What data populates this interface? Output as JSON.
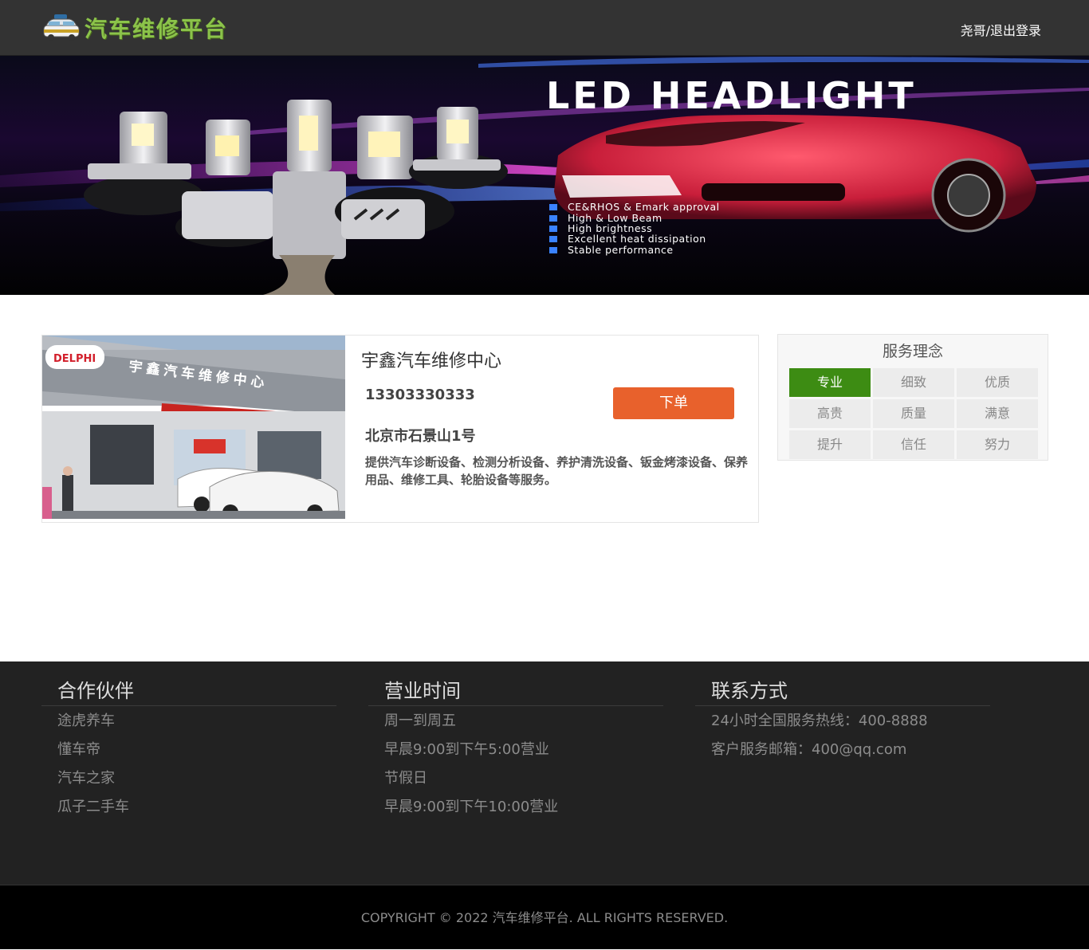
{
  "header": {
    "logo_text": "汽车维修平台",
    "username": "尧哥",
    "separator": "/",
    "logout_label": "退出登录"
  },
  "banner": {
    "headline": "LED HEADLIGHT",
    "features": [
      "CE&RHOS & Emark approval",
      "High & Low Beam",
      "High brightness",
      "Excellent heat dissipation",
      "Stable performance"
    ]
  },
  "shop": {
    "name": "宇鑫汽车维修中心",
    "phone": "13303330333",
    "address": "北京市石景山1号",
    "description": "提供汽车诊断设备、检测分析设备、养护清洗设备、钣金烤漆设备、保养用品、维修工具、轮胎设备等服务。",
    "order_label": "下单",
    "photo": {
      "sign_text": "宇鑫汽车维修中心",
      "brand_text": "DELPHI"
    }
  },
  "service": {
    "title": "服务理念",
    "items": [
      "专业",
      "细致",
      "优质",
      "高贵",
      "质量",
      "满意",
      "提升",
      "信任",
      "努力"
    ],
    "active_index": 0
  },
  "footer": {
    "partners": {
      "title": "合作伙伴",
      "items": [
        "途虎养车",
        "懂车帝",
        "汽车之家",
        "瓜子二手车"
      ]
    },
    "hours": {
      "title": "营业时间",
      "items": [
        "周一到周五",
        "早晨9:00到下午5:00营业",
        "节假日",
        "早晨9:00到下午10:00营业"
      ]
    },
    "contact": {
      "title": "联系方式",
      "items": [
        "24小时全国服务热线：400-8888",
        "客户服务邮箱：400@qq.com"
      ]
    },
    "copyright": "COPYRIGHT © 2022 汽车维修平台. ALL RIGHTS RESERVED."
  },
  "colors": {
    "header_bg": "#333333",
    "logo_green": "#8bc34a",
    "order_orange": "#e8612c",
    "active_green": "#3d8c13",
    "footer_bg": "#222222"
  }
}
